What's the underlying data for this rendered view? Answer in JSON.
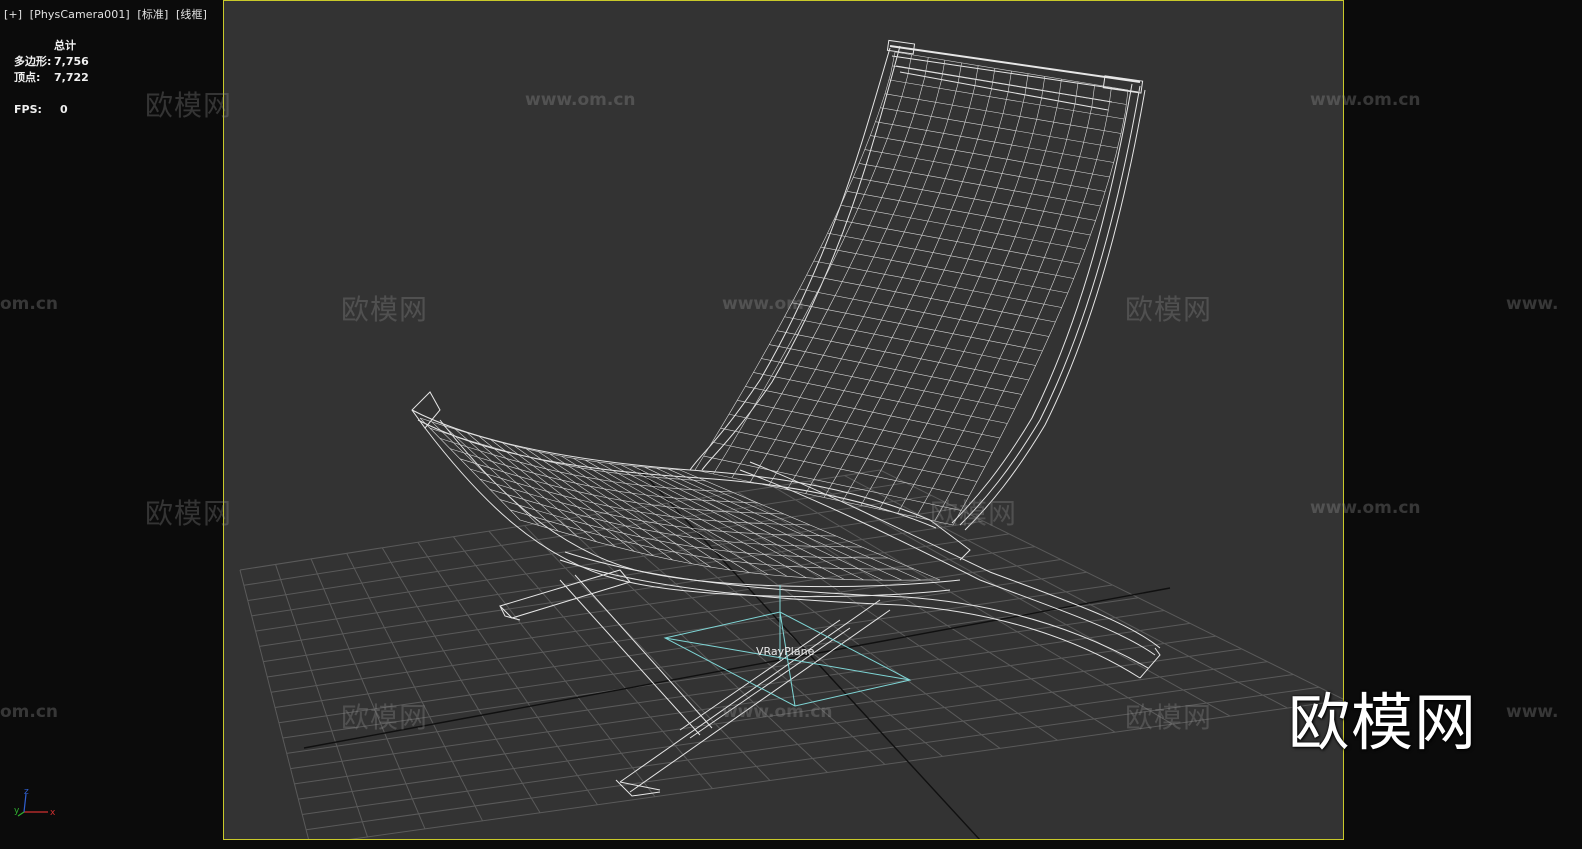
{
  "viewport": {
    "label_parts": [
      "[+]",
      "[PhysCamera001]",
      "[标准]",
      "[线框]"
    ]
  },
  "stats": {
    "header": "总计",
    "polygons_label": "多边形:",
    "polygons_value": "7,756",
    "vertices_label": "顶点:",
    "vertices_value": "7,722",
    "fps_label": "FPS:",
    "fps_value": "0"
  },
  "scene": {
    "object_label": "VRayPlane"
  },
  "watermarks": {
    "url_text": "www.om.cn",
    "url_partial_left": "om.cn",
    "url_partial_right": "www.",
    "url_partial_mid": "www.om",
    "cn_text": "欧模网",
    "cn_partial": "欧模网"
  },
  "brand": {
    "logo_text": "欧模网"
  },
  "axis": {
    "x": "x",
    "y": "y",
    "z": "z"
  },
  "colors": {
    "viewport_bg": "#333333",
    "safe_frame_border": "#c9c92a",
    "wireframe": "#e6e6e6",
    "grid": "#5a5a5a",
    "vrayplane": "#7fd6d6"
  }
}
